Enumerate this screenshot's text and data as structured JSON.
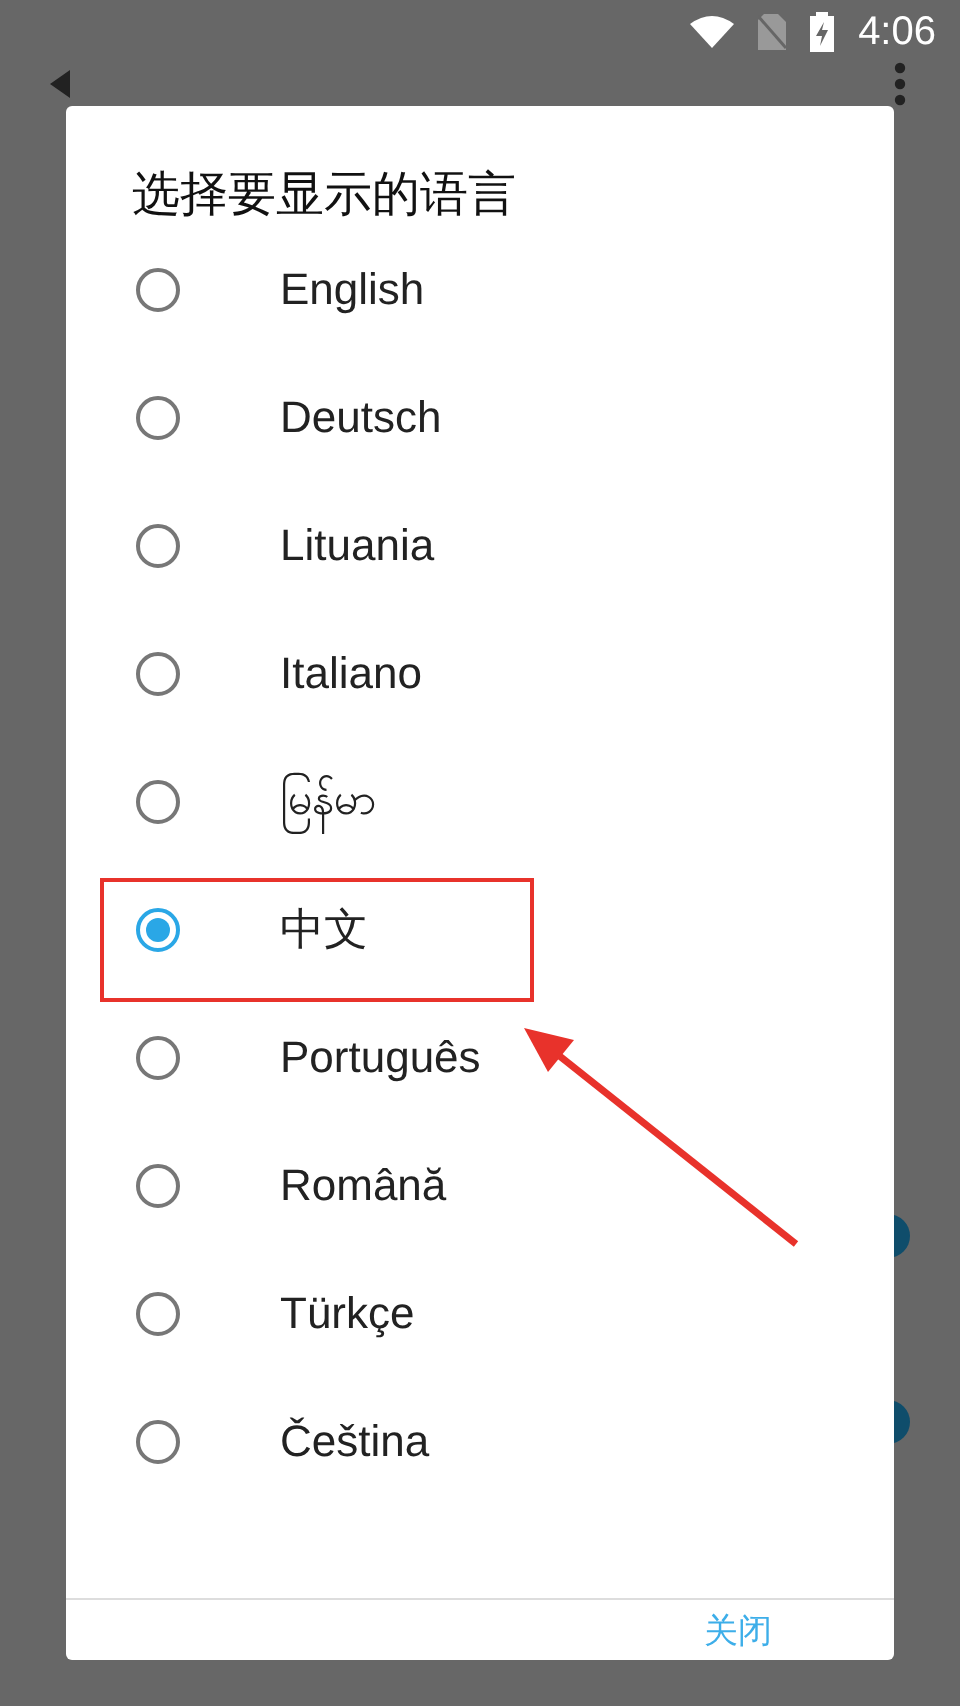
{
  "status_bar": {
    "time": "4:06"
  },
  "switches": [
    {
      "on": true
    },
    {
      "on": true
    }
  ],
  "dialog": {
    "title": "选择要显示的语言",
    "options": [
      {
        "label": "English",
        "selected": false
      },
      {
        "label": "Deutsch",
        "selected": false
      },
      {
        "label": "Lituania",
        "selected": false
      },
      {
        "label": "Italiano",
        "selected": false
      },
      {
        "label": "မြန်မာ",
        "selected": false
      },
      {
        "label": "中文",
        "selected": true
      },
      {
        "label": "Português",
        "selected": false
      },
      {
        "label": "Română",
        "selected": false
      },
      {
        "label": "Türkçe",
        "selected": false
      },
      {
        "label": "Čeština",
        "selected": false
      }
    ],
    "button": "关闭"
  }
}
